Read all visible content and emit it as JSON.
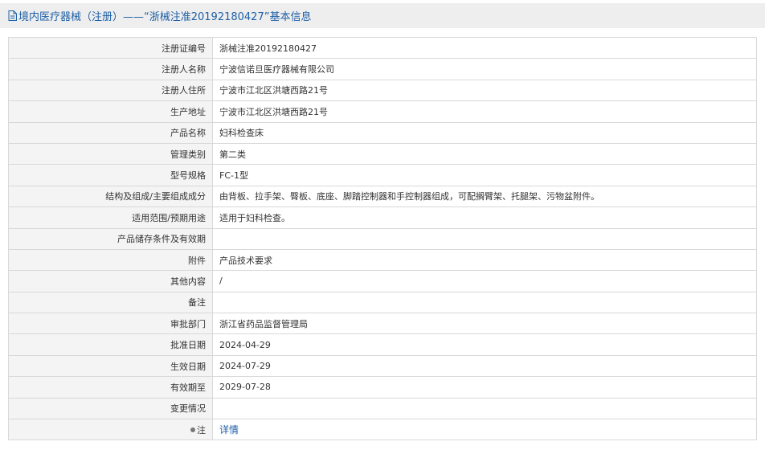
{
  "header": {
    "icon": "document-icon",
    "title": "境内医疗器械（注册）——“浙械注准20192180427”基本信息"
  },
  "rows": [
    {
      "label": "注册证编号",
      "value": "浙械注准20192180427"
    },
    {
      "label": "注册人名称",
      "value": "宁波信诺旦医疗器械有限公司"
    },
    {
      "label": "注册人住所",
      "value": "宁波市江北区洪塘西路21号"
    },
    {
      "label": "生产地址",
      "value": "宁波市江北区洪塘西路21号"
    },
    {
      "label": "产品名称",
      "value": "妇科检查床"
    },
    {
      "label": "管理类别",
      "value": "第二类"
    },
    {
      "label": "型号规格",
      "value": "FC-1型"
    },
    {
      "label": "结构及组成/主要组成成分",
      "value": "由背板、拉手架、臀板、底座、脚踏控制器和手控制器组成，可配搁臂架、托腿架、污物盆附件。"
    },
    {
      "label": "适用范围/预期用途",
      "value": "适用于妇科检查。"
    },
    {
      "label": "产品储存条件及有效期",
      "value": ""
    },
    {
      "label": "附件",
      "value": "产品技术要求"
    },
    {
      "label": "其他内容",
      "value": "/"
    },
    {
      "label": "备注",
      "value": ""
    },
    {
      "label": "审批部门",
      "value": "浙江省药品监督管理局"
    },
    {
      "label": "批准日期",
      "value": "2024-04-29"
    },
    {
      "label": "生效日期",
      "value": "2024-07-29"
    },
    {
      "label": "有效期至",
      "value": "2029-07-28"
    },
    {
      "label": "变更情况",
      "value": ""
    }
  ],
  "note": {
    "icon": "info-dot-icon",
    "label": "注",
    "link": "详情"
  },
  "colors": {
    "accent": "#1e5fa5",
    "label_bg": "#f4f4f4",
    "header_bg": "#eeeeee",
    "border": "#d8d8d8"
  }
}
